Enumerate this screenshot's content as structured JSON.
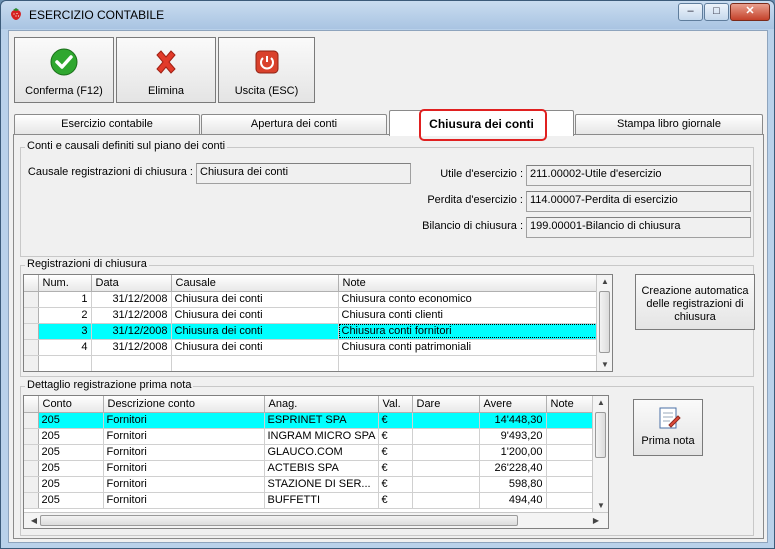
{
  "window": {
    "title": "ESERCIZIO CONTABILE",
    "min": "–",
    "max": "□",
    "close": "✕"
  },
  "toolbar": {
    "confirm_label": "Conferma (F12)",
    "delete_label": "Elimina",
    "exit_label": "Uscita (ESC)"
  },
  "tabs": [
    {
      "label": "Esercizio contabile"
    },
    {
      "label": "Apertura dei conti"
    },
    {
      "label": "Chiusura dei conti"
    },
    {
      "label": "Stampa libro giornale"
    }
  ],
  "accounts_group": {
    "title": "Conti e causali definiti sul piano dei conti",
    "causale_label": "Causale registrazioni di chiusura :",
    "causale_value": "Chiusura dei conti",
    "utile_label": "Utile d'esercizio :",
    "utile_value": "211.00002-Utile d'esercizio",
    "perdita_label": "Perdita d'esercizio :",
    "perdita_value": "114.00007-Perdita di esercizio",
    "bilancio_label": "Bilancio di chiusura :",
    "bilancio_value": "199.00001-Bilancio di chiusura"
  },
  "closing_group": {
    "title": "Registrazioni di chiusura",
    "columns": [
      "Num.",
      "Data",
      "Causale",
      "Note"
    ],
    "rows": [
      {
        "num": "1",
        "data": "31/12/2008",
        "causale": "Chiusura dei conti",
        "note": "Chiusura conto economico"
      },
      {
        "num": "2",
        "data": "31/12/2008",
        "causale": "Chiusura dei conti",
        "note": "Chiusura conti clienti"
      },
      {
        "num": "3",
        "data": "31/12/2008",
        "causale": "Chiusura dei conti",
        "note": "Chiusura conti fornitori"
      },
      {
        "num": "4",
        "data": "31/12/2008",
        "causale": "Chiusura dei conti",
        "note": "Chiusura conti patrimoniali"
      }
    ],
    "auto_button_label": "Creazione automatica delle registrazioni di chiusura"
  },
  "detail_group": {
    "title": "Dettaglio registrazione prima nota",
    "columns": [
      "Conto",
      "Descrizione conto",
      "Anag.",
      "Val.",
      "Dare",
      "Avere",
      "Note"
    ],
    "rows": [
      {
        "conto": "205",
        "descr": "Fornitori",
        "anag": "ESPRINET SPA",
        "val": "€",
        "dare": "",
        "avere": "14'448,30",
        "note": ""
      },
      {
        "conto": "205",
        "descr": "Fornitori",
        "anag": "INGRAM MICRO SPA",
        "val": "€",
        "dare": "",
        "avere": "9'493,20",
        "note": ""
      },
      {
        "conto": "205",
        "descr": "Fornitori",
        "anag": "GLAUCO.COM",
        "val": "€",
        "dare": "",
        "avere": "1'200,00",
        "note": ""
      },
      {
        "conto": "205",
        "descr": "Fornitori",
        "anag": "ACTEBIS SPA",
        "val": "€",
        "dare": "",
        "avere": "26'228,40",
        "note": ""
      },
      {
        "conto": "205",
        "descr": "Fornitori",
        "anag": "STAZIONE DI SER...",
        "val": "€",
        "dare": "",
        "avere": "598,80",
        "note": ""
      },
      {
        "conto": "205",
        "descr": "Fornitori",
        "anag": "BUFFETTI",
        "val": "€",
        "dare": "",
        "avere": "494,40",
        "note": ""
      }
    ],
    "prima_nota_label": "Prima nota"
  },
  "icons": {
    "app": "strawberry-icon",
    "confirm": "check-icon",
    "delete": "x-icon",
    "exit": "power-icon",
    "prima_nota": "document-edit-icon"
  },
  "colors": {
    "selected_row": "#00ffff",
    "highlight_ring": "#e02020"
  }
}
